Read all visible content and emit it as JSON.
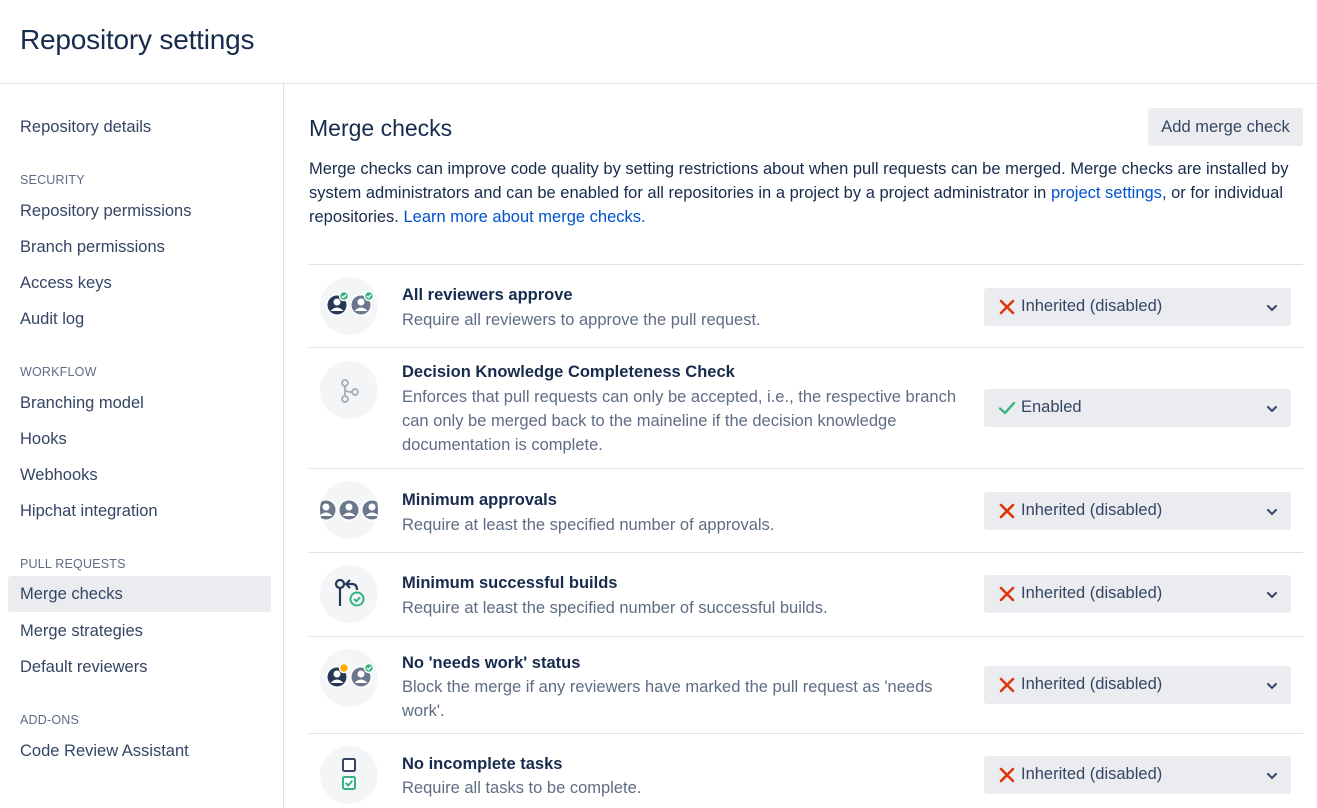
{
  "page": {
    "title": "Repository settings"
  },
  "sidebar": {
    "top_item": "Repository details",
    "sections": [
      {
        "heading": "SECURITY",
        "items": [
          "Repository permissions",
          "Branch permissions",
          "Access keys",
          "Audit log"
        ]
      },
      {
        "heading": "WORKFLOW",
        "items": [
          "Branching model",
          "Hooks",
          "Webhooks",
          "Hipchat integration"
        ]
      },
      {
        "heading": "PULL REQUESTS",
        "items": [
          "Merge checks",
          "Merge strategies",
          "Default reviewers"
        ]
      },
      {
        "heading": "ADD-ONS",
        "items": [
          "Code Review Assistant"
        ]
      }
    ],
    "active_item": "Merge checks"
  },
  "main": {
    "title": "Merge checks",
    "add_button": "Add merge check",
    "intro": {
      "text_1": "Merge checks can improve code quality by setting restrictions about when pull requests can be merged. Merge checks are installed by system administrators and can be enabled for all repositories in a project by a project administrator in ",
      "link_1": "project settings",
      "text_2": ", or for individual repositories. ",
      "link_2": "Learn more about merge checks."
    },
    "checks": [
      {
        "name": "All reviewers approve",
        "description": "Require all reviewers to approve the pull request.",
        "status": "Inherited (disabled)",
        "status_kind": "disabled",
        "icon": "reviewers-approved-icon"
      },
      {
        "name": "Decision Knowledge Completeness Check",
        "description": "Enforces that pull requests can only be accepted, i.e., the respective branch can only be merged back to the maineline if the decision knowledge documentation is complete.",
        "status": "Enabled",
        "status_kind": "enabled",
        "icon": "branch-icon"
      },
      {
        "name": "Minimum approvals",
        "description": "Require at least the specified number of approvals.",
        "status": "Inherited (disabled)",
        "status_kind": "disabled",
        "icon": "approvals-avatars-icon"
      },
      {
        "name": "Minimum successful builds",
        "description": "Require at least the specified number of successful builds.",
        "status": "Inherited (disabled)",
        "status_kind": "disabled",
        "icon": "successful-builds-icon"
      },
      {
        "name": "No 'needs work' status",
        "description": "Block the merge if any reviewers have marked the pull request as 'needs work'.",
        "status": "Inherited (disabled)",
        "status_kind": "disabled",
        "icon": "needs-work-icon"
      },
      {
        "name": "No incomplete tasks",
        "description": "Require all tasks to be complete.",
        "status": "Inherited (disabled)",
        "status_kind": "disabled",
        "icon": "tasks-icon"
      }
    ]
  },
  "colors": {
    "link": "#0052cc",
    "disabled_x": "#de350b",
    "enabled_check": "#36b37e",
    "avatar_blue": "#253858",
    "active_nav": "#ebecf0"
  }
}
